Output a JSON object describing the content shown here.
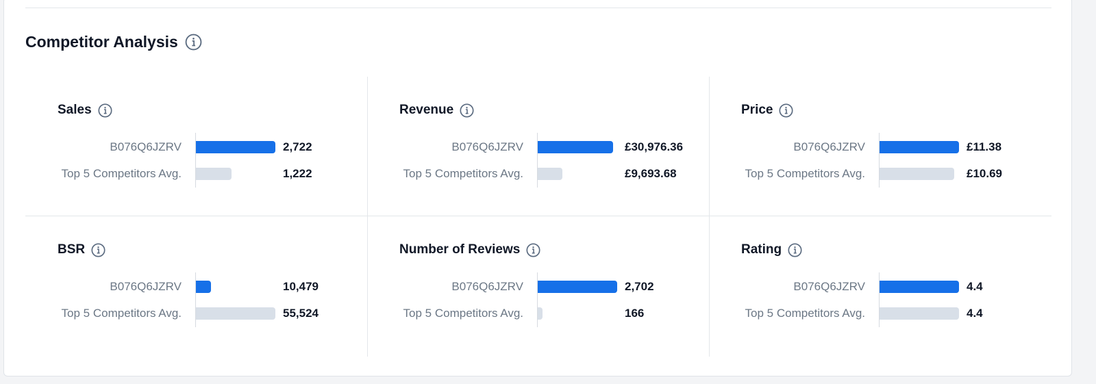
{
  "section": {
    "title": "Competitor Analysis",
    "info_icon": "info-circle-icon"
  },
  "colors": {
    "primary_bar": "#1670e8",
    "compare_bar": "#d8dfe8",
    "icon": "#5b6b80"
  },
  "panels": [
    {
      "id": "sales",
      "title": "Sales",
      "rows": [
        {
          "label": "B076Q6JZRV",
          "value": "2,722",
          "fill": 1.0,
          "kind": "primary"
        },
        {
          "label": "Top 5 Competitors Avg.",
          "value": "1,222",
          "fill": 0.45,
          "kind": "compare"
        }
      ]
    },
    {
      "id": "revenue",
      "title": "Revenue",
      "rows": [
        {
          "label": "B076Q6JZRV",
          "value": "£30,976.36",
          "fill": 0.95,
          "kind": "primary"
        },
        {
          "label": "Top 5 Competitors Avg.",
          "value": "£9,693.68",
          "fill": 0.31,
          "kind": "compare"
        }
      ]
    },
    {
      "id": "price",
      "title": "Price",
      "rows": [
        {
          "label": "B076Q6JZRV",
          "value": "£11.38",
          "fill": 1.0,
          "kind": "primary"
        },
        {
          "label": "Top 5 Competitors Avg.",
          "value": "£10.69",
          "fill": 0.94,
          "kind": "compare"
        }
      ]
    },
    {
      "id": "bsr",
      "title": "BSR",
      "rows": [
        {
          "label": "B076Q6JZRV",
          "value": "10,479",
          "fill": 0.19,
          "kind": "primary"
        },
        {
          "label": "Top 5 Competitors Avg.",
          "value": "55,524",
          "fill": 1.0,
          "kind": "compare"
        }
      ]
    },
    {
      "id": "reviews",
      "title": "Number of Reviews",
      "rows": [
        {
          "label": "B076Q6JZRV",
          "value": "2,702",
          "fill": 1.0,
          "kind": "primary"
        },
        {
          "label": "Top 5 Competitors Avg.",
          "value": "166",
          "fill": 0.06,
          "kind": "compare"
        }
      ]
    },
    {
      "id": "rating",
      "title": "Rating",
      "rows": [
        {
          "label": "B076Q6JZRV",
          "value": "4.4",
          "fill": 1.0,
          "kind": "primary"
        },
        {
          "label": "Top 5 Competitors Avg.",
          "value": "4.4",
          "fill": 1.0,
          "kind": "compare"
        }
      ]
    }
  ]
}
